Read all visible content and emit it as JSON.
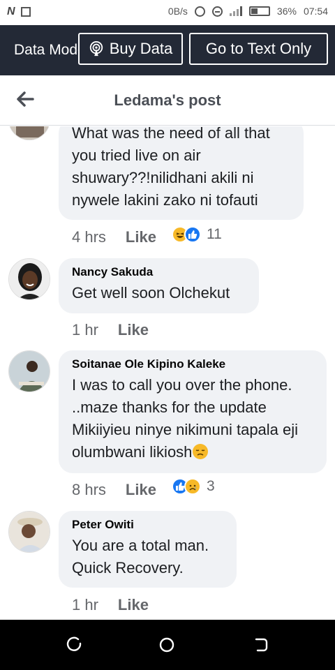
{
  "status_bar": {
    "speed": "0B/s",
    "battery": "36%",
    "time": "07:54",
    "icons": [
      "n-icon",
      "screen-icon",
      "data-saver-icon",
      "dnd-icon",
      "signal-icon",
      "battery-icon"
    ]
  },
  "banner": {
    "mode_text": "Data Mode",
    "buy_data_label": "Buy Data",
    "text_only_label": "Go to Text Only",
    "background": "#232936"
  },
  "header": {
    "title": "Ledama's post"
  },
  "comments": [
    {
      "author": "",
      "text": "What was the need of all that you tried live on air shuwary??!nilidhani akili ni nywele lakini zako ni tofauti",
      "time": "4 hrs",
      "like_label": "Like",
      "reactions": [
        "haha",
        "like"
      ],
      "reaction_count": "11"
    },
    {
      "author": "Nancy Sakuda",
      "text": "Get well soon Olchekut",
      "time": "1 hr",
      "like_label": "Like",
      "reactions": [],
      "reaction_count": ""
    },
    {
      "author": "Soitanae Ole Kipino Kaleke",
      "text": "I was to call you over the phone. ..maze thanks for the update Mikiiyieu ninye nikimuni tapala eji olumbwani likiosh",
      "time": "8 hrs",
      "like_label": "Like",
      "reactions": [
        "like",
        "sad"
      ],
      "reaction_count": "3"
    },
    {
      "author": "Peter Owiti",
      "text": "You are a total man. Quick Recovery.",
      "time": "1 hr",
      "like_label": "Like",
      "reactions": [],
      "reaction_count": ""
    }
  ],
  "colors": {
    "like_blue": "#1877f2",
    "emoji_yellow": "#f7b928",
    "bubble": "#f0f2f5",
    "meta_gray": "#65676b"
  }
}
